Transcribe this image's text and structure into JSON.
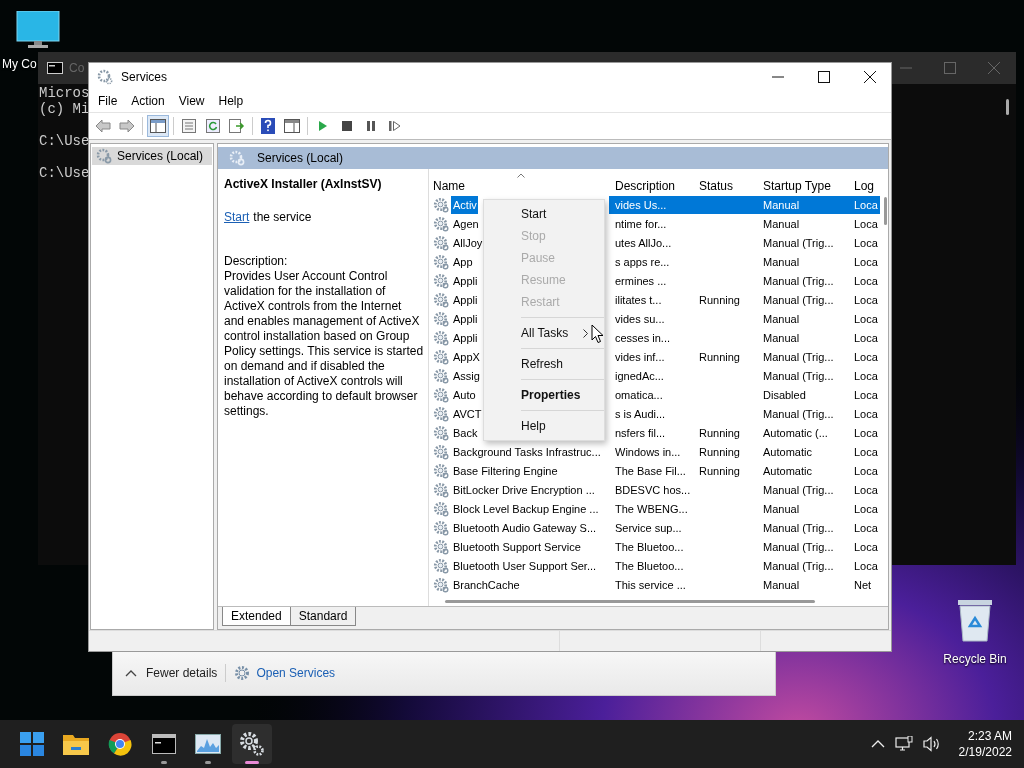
{
  "desktop_icons": [
    {
      "kind": "computer",
      "label": "My Co"
    },
    {
      "kind": "recycle",
      "label": "Recycle Bin"
    }
  ],
  "console_window": {
    "title": "Co",
    "paragraphs": [
      [
        "Micros",
        "(c) Mi"
      ],
      [
        "C:\\Use"
      ],
      [
        "C:\\Use"
      ]
    ]
  },
  "task_manager": {
    "toggle": "Fewer details",
    "link": "Open Services"
  },
  "services_window": {
    "title": "Services",
    "menu": [
      "File",
      "Action",
      "View",
      "Help"
    ],
    "toolbar": [
      {
        "kind": "back",
        "on": false
      },
      {
        "kind": "forward",
        "on": false
      },
      {
        "kind": "separator"
      },
      {
        "kind": "tree",
        "on": true
      },
      {
        "kind": "separator"
      },
      {
        "kind": "properties",
        "on": false
      },
      {
        "kind": "refresh",
        "on": false
      },
      {
        "kind": "export",
        "on": false
      },
      {
        "kind": "separator"
      },
      {
        "kind": "help",
        "on": false
      },
      {
        "kind": "pane",
        "on": false
      },
      {
        "kind": "separator"
      },
      {
        "kind": "play",
        "on": false
      },
      {
        "kind": "stop",
        "on": false
      },
      {
        "kind": "pause",
        "on": false
      },
      {
        "kind": "resume",
        "on": false
      }
    ],
    "tree": [
      {
        "label": "Services (Local)",
        "selected": true
      }
    ],
    "pane_title": "Services (Local)",
    "detail": {
      "heading": "ActiveX Installer (AxInstSV)",
      "action_link": "Start",
      "action_rest": "the service",
      "description_label": "Description:",
      "description": "Provides User Account Control validation for the installation of ActiveX controls from the Internet and enables management of ActiveX control installation based on Group Policy settings. This service is started on demand and if disabled the installation of ActiveX controls will behave according to default browser settings."
    },
    "table": {
      "columns": [
        "Name",
        "Description",
        "Status",
        "Startup Type",
        "Log"
      ],
      "rows": [
        {
          "name": "Activ",
          "description": "vides Us...",
          "startup": "Manual",
          "log": "Loca",
          "selected": true
        },
        {
          "name": "Agen",
          "description": "ntime for...",
          "startup": "Manual",
          "log": "Loca",
          "selected": false
        },
        {
          "name": "AllJoy",
          "description": "utes AllJo...",
          "startup": "Manual (Trig...",
          "log": "Loca",
          "selected": false
        },
        {
          "name": "App",
          "description": "s apps re...",
          "startup": "Manual",
          "log": "Loca",
          "selected": false
        },
        {
          "name": "Appli",
          "description": "ermines ...",
          "startup": "Manual (Trig...",
          "log": "Loca",
          "selected": false
        },
        {
          "name": "Appli",
          "description": "ilitates t...",
          "status": "Running",
          "startup": "Manual (Trig...",
          "log": "Loca",
          "selected": false
        },
        {
          "name": "Appli",
          "description": "vides su...",
          "startup": "Manual",
          "log": "Loca",
          "selected": false
        },
        {
          "name": "Appli",
          "description": "cesses in...",
          "startup": "Manual",
          "log": "Loca",
          "selected": false
        },
        {
          "name": "AppX",
          "description": "vides inf...",
          "status": "Running",
          "startup": "Manual (Trig...",
          "log": "Loca",
          "selected": false
        },
        {
          "name": "Assig",
          "description": "ignedAc...",
          "startup": "Manual (Trig...",
          "log": "Loca",
          "selected": false
        },
        {
          "name": "Auto",
          "description": "omatica...",
          "startup": "Disabled",
          "log": "Loca",
          "selected": false
        },
        {
          "name": "AVCT",
          "description": "s is Audi...",
          "startup": "Manual (Trig...",
          "log": "Loca",
          "selected": false
        },
        {
          "name": "Back",
          "description": "nsfers fil...",
          "status": "Running",
          "startup": "Automatic (...",
          "log": "Loca",
          "selected": false
        },
        {
          "name": "Background Tasks Infrastruc...",
          "description": "Windows in...",
          "status": "Running",
          "startup": "Automatic",
          "log": "Loca",
          "selected": false
        },
        {
          "name": "Base Filtering Engine",
          "description": "The Base Fil...",
          "status": "Running",
          "startup": "Automatic",
          "log": "Loca",
          "selected": false
        },
        {
          "name": "BitLocker Drive Encryption ...",
          "description": "BDESVC hos...",
          "startup": "Manual (Trig...",
          "log": "Loca",
          "selected": false
        },
        {
          "name": "Block Level Backup Engine ...",
          "description": "The WBENG...",
          "startup": "Manual",
          "log": "Loca",
          "selected": false
        },
        {
          "name": "Bluetooth Audio Gateway S...",
          "description": "Service sup...",
          "startup": "Manual (Trig...",
          "log": "Loca",
          "selected": false
        },
        {
          "name": "Bluetooth Support Service",
          "description": "The Bluetoo...",
          "startup": "Manual (Trig...",
          "log": "Loca",
          "selected": false
        },
        {
          "name": "Bluetooth User Support Ser...",
          "description": "The Bluetoo...",
          "startup": "Manual (Trig...",
          "log": "Loca",
          "selected": false
        },
        {
          "name": "BranchCache",
          "description": "This service ...",
          "startup": "Manual",
          "log": "Net",
          "selected": false
        }
      ]
    },
    "context_menu": [
      {
        "kind": "item",
        "label": "Start",
        "disabled": false,
        "bold": false
      },
      {
        "kind": "item",
        "label": "Stop",
        "disabled": true,
        "bold": false
      },
      {
        "kind": "item",
        "label": "Pause",
        "disabled": true,
        "bold": false
      },
      {
        "kind": "item",
        "label": "Resume",
        "disabled": true,
        "bold": false
      },
      {
        "kind": "item",
        "label": "Restart",
        "disabled": true,
        "bold": false
      },
      {
        "kind": "separator"
      },
      {
        "kind": "submenu",
        "label": "All Tasks",
        "disabled": false,
        "bold": false
      },
      {
        "kind": "separator"
      },
      {
        "kind": "item",
        "label": "Refresh",
        "disabled": false,
        "bold": false
      },
      {
        "kind": "separator"
      },
      {
        "kind": "item",
        "label": "Properties",
        "disabled": false,
        "bold": true
      },
      {
        "kind": "separator"
      },
      {
        "kind": "item",
        "label": "Help",
        "disabled": false,
        "bold": false
      }
    ],
    "tabs": [
      {
        "label": "Extended",
        "selected": true
      },
      {
        "label": "Standard",
        "selected": false
      }
    ]
  },
  "taskbar": {
    "apps": [
      {
        "kind": "start",
        "running": false,
        "active": false
      },
      {
        "kind": "folder",
        "running": false,
        "active": false
      },
      {
        "kind": "browser",
        "running": false,
        "active": false
      },
      {
        "kind": "terminal",
        "running": true,
        "active": false
      },
      {
        "kind": "monitor",
        "running": true,
        "active": false
      },
      {
        "kind": "gears",
        "running": true,
        "active": true
      }
    ],
    "time": "2:23 AM",
    "date": "2/19/2022"
  }
}
